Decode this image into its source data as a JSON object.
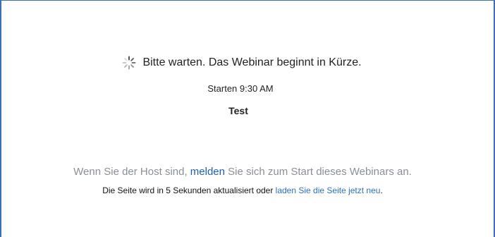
{
  "waiting": {
    "icon": "loading-spinner-icon",
    "message": "Bitte warten. Das Webinar beginnt in Kürze."
  },
  "start": {
    "label": "Starten 9:30 AM"
  },
  "webinar": {
    "title": "Test"
  },
  "host": {
    "text_before": "Wenn Sie der Host sind, ",
    "login_link": "melden",
    "text_after": " Sie sich zum Start dieses Webinars an."
  },
  "refresh": {
    "text_before": "Die Seite wird in 5 Sekunden aktualisiert oder ",
    "reload_link": "laden Sie die Seite jetzt neu",
    "text_after": "."
  },
  "colors": {
    "frame_border": "#3a6fb5",
    "link": "#2060b0",
    "muted_text": "#8a8f96"
  }
}
